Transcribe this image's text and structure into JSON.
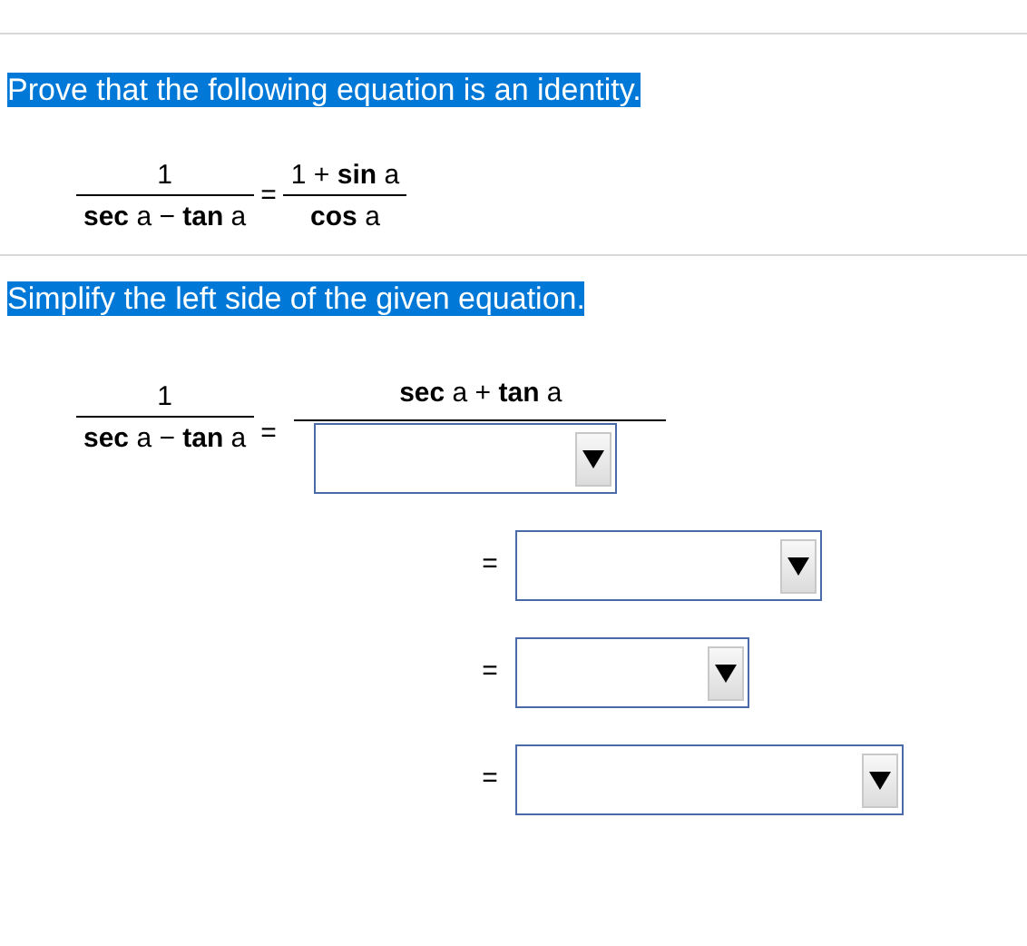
{
  "prompt": "Prove that the following equation is an identity.",
  "identity": {
    "left": {
      "numerator": "1",
      "denominator": "**sec** a − **tan** a"
    },
    "equals": "=",
    "right": {
      "numerator": "1 + **sin** a",
      "denominator": "**cos** a"
    }
  },
  "instruction": "Simplify the left side of the given equation.",
  "work": {
    "left": {
      "numerator": "1",
      "denominator": "**sec** a − **tan** a"
    },
    "steps": [
      {
        "kind": "fraction",
        "equals": "=",
        "numerator": "**sec** a + **tan** a"
      },
      {
        "kind": "dropdown",
        "equals": "="
      },
      {
        "kind": "dropdown",
        "equals": "="
      },
      {
        "kind": "dropdown",
        "equals": "="
      }
    ]
  }
}
